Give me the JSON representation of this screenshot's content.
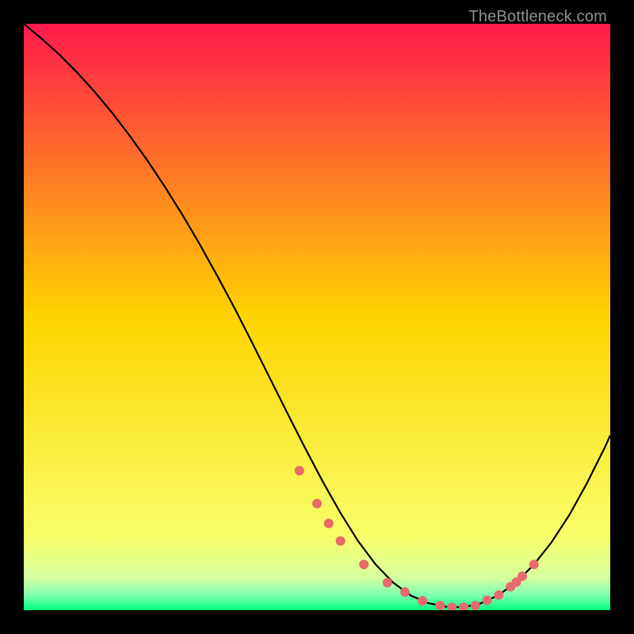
{
  "watermark": "TheBottleneck.com",
  "chart_data": {
    "type": "line",
    "title": "",
    "xlabel": "",
    "ylabel": "",
    "xlim": [
      0,
      100
    ],
    "ylim": [
      0,
      100
    ],
    "background_gradient": {
      "stops": [
        {
          "offset": 0.0,
          "color": "#ff1a4c"
        },
        {
          "offset": 0.5,
          "color": "#ffd400"
        },
        {
          "offset": 0.88,
          "color": "#f7ff6a"
        },
        {
          "offset": 0.945,
          "color": "#d4ffa0"
        },
        {
          "offset": 0.975,
          "color": "#7affb0"
        },
        {
          "offset": 1.0,
          "color": "#00ff7a"
        }
      ]
    },
    "series": [
      {
        "name": "curve",
        "type": "line",
        "color": "#000000",
        "x": [
          0,
          3,
          6,
          9,
          12,
          15,
          18,
          21,
          24,
          27,
          30,
          33,
          36,
          39,
          42,
          45,
          48,
          51,
          54,
          57,
          60,
          63,
          66,
          69,
          72,
          75,
          78,
          81,
          84,
          87,
          90,
          93,
          96,
          99,
          100
        ],
        "y": [
          100,
          97.5,
          94.8,
          91.8,
          88.5,
          84.9,
          81.0,
          76.8,
          72.3,
          67.5,
          62.4,
          57.0,
          51.4,
          45.5,
          39.5,
          33.5,
          27.6,
          21.9,
          16.6,
          11.8,
          7.8,
          4.7,
          2.5,
          1.2,
          0.6,
          0.5,
          1.2,
          2.6,
          4.8,
          7.8,
          11.6,
          16.2,
          21.6,
          27.6,
          29.8
        ]
      },
      {
        "name": "dots",
        "type": "scatter",
        "color": "#e86a6a",
        "x": [
          47,
          50,
          52,
          54,
          58,
          62,
          65,
          68,
          71,
          73,
          75,
          77,
          79,
          81,
          83,
          84,
          85,
          87
        ],
        "y": [
          23.8,
          18.2,
          14.8,
          11.8,
          7.8,
          4.7,
          3.1,
          1.6,
          0.8,
          0.5,
          0.5,
          0.8,
          1.7,
          2.6,
          4.0,
          4.8,
          5.8,
          7.8
        ]
      }
    ]
  }
}
